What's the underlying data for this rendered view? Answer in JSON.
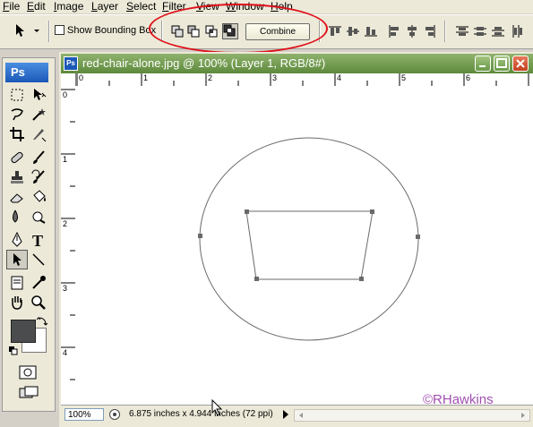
{
  "menu": [
    "File",
    "Edit",
    "Image",
    "Layer",
    "Select",
    "Filter",
    "View",
    "Window",
    "Help"
  ],
  "options": {
    "show_bounding_box_label": "Show Bounding Box",
    "combine_label": "Combine"
  },
  "toolbox": {
    "logo": "Ps"
  },
  "document": {
    "title": "red-chair-alone.jpg @ 100% (Layer 1, RGB/8#)",
    "zoom": "100%",
    "info": "6.875 inches x 4.944 inches (72 ppi)",
    "h_ruler": [
      "0",
      "1",
      "2",
      "3",
      "4",
      "5",
      "6"
    ],
    "v_ruler": [
      "0",
      "1",
      "2",
      "3",
      "4"
    ]
  },
  "watermark": "©RHawkins",
  "colors": {
    "titlebar": "#6f9b4e",
    "highlight": "#e0101a",
    "foreground_swatch": "#4a4c4e"
  }
}
